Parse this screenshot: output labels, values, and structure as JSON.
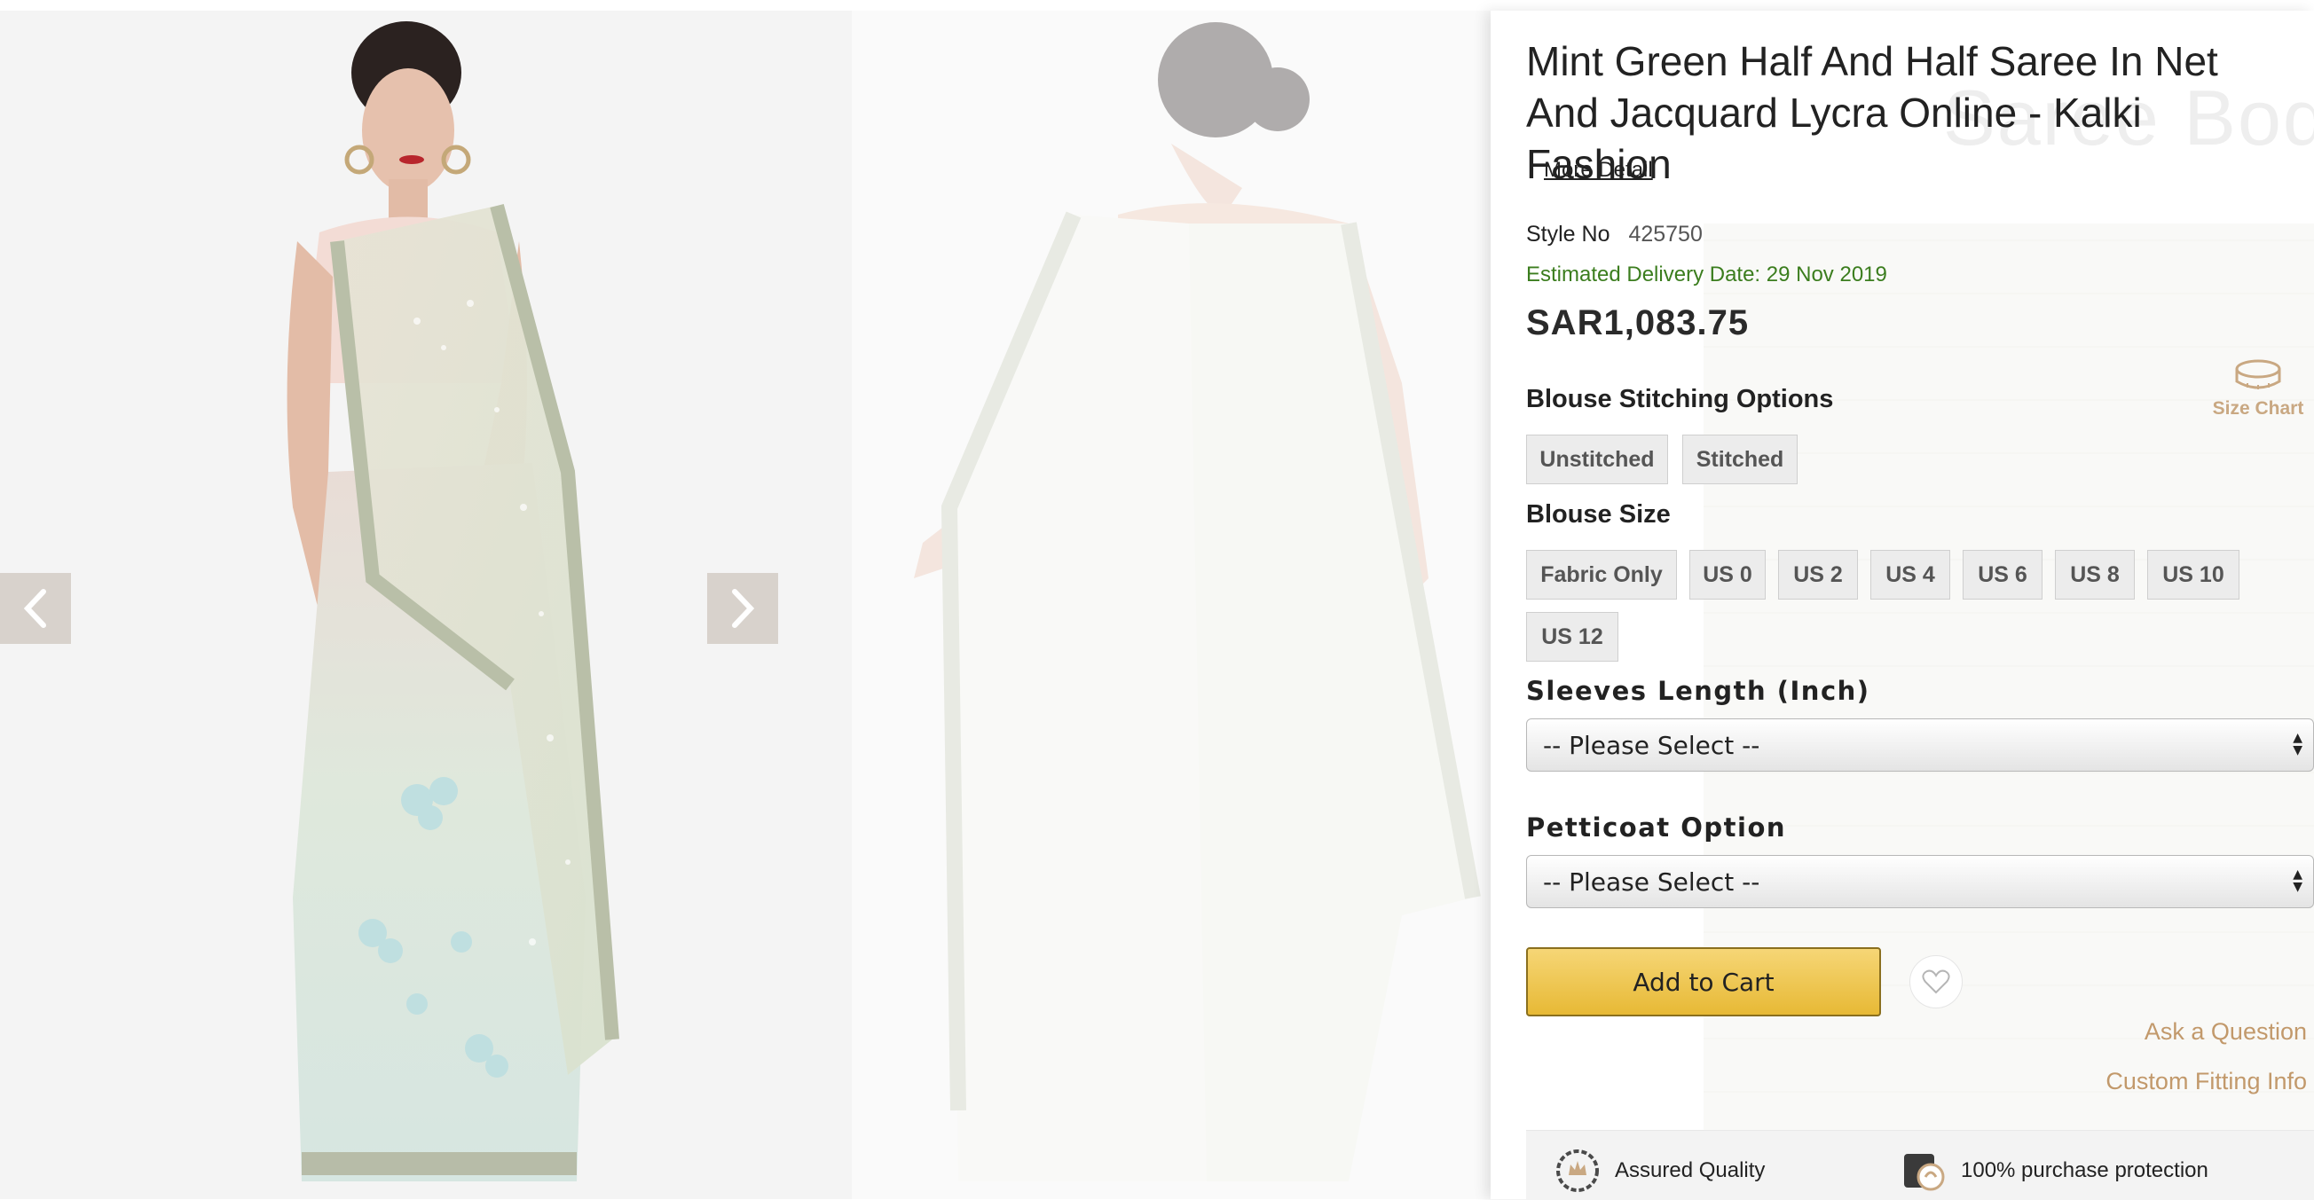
{
  "gallery": {
    "prev_icon": "chevron-left-icon",
    "next_icon": "chevron-right-icon"
  },
  "product": {
    "title": "Mint Green Half And Half Saree In Net And Jacquard Lycra Online - Kalki Fashion",
    "watermark": "Saree Body",
    "more_detail": "More Detail",
    "style_label": "Style No",
    "style_value": "425750",
    "delivery": "Estimated Delivery Date: 29 Nov 2019",
    "price": "SAR1,083.75",
    "size_chart_label": "Size Chart"
  },
  "blouse_stitching": {
    "heading": "Blouse Stitching Options",
    "options": [
      "Unstitched",
      "Stitched"
    ]
  },
  "blouse_size": {
    "heading": "Blouse Size",
    "options": [
      "Fabric Only",
      "US 0",
      "US 2",
      "US 4",
      "US 6",
      "US 8",
      "US 10",
      "US 12"
    ]
  },
  "sleeves": {
    "heading": "Sleeves Length (Inch)",
    "selected": "-- Please Select --"
  },
  "petticoat": {
    "heading": "Petticoat Option",
    "selected": "-- Please Select --"
  },
  "actions": {
    "add_to_cart": "Add to Cart",
    "ask_question": "Ask a Question",
    "custom_fitting": "Custom Fitting Info"
  },
  "assurance": {
    "quality": "Assured Quality",
    "protection": "100% purchase protection"
  },
  "colors": {
    "accent_gold": "#e7b935",
    "link_tan": "#c2996b",
    "delivery_green": "#3b7d1e"
  }
}
